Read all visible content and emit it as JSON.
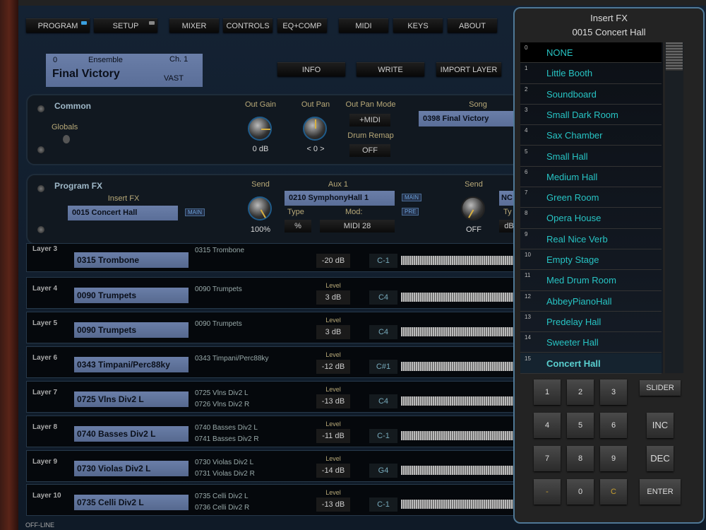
{
  "nav": {
    "tabs": [
      "PROGRAM",
      "SETUP",
      "MIXER",
      "CONTROLS",
      "EQ+COMP",
      "MIDI",
      "KEYS",
      "ABOUT"
    ]
  },
  "program": {
    "number": "0",
    "bank": "Ensemble",
    "channel": "Ch. 1",
    "name": "Final Victory",
    "type": "VAST"
  },
  "actions": {
    "info": "INFO",
    "write": "WRITE",
    "import": "IMPORT LAYER"
  },
  "common": {
    "title": "Common",
    "globals": "Globals",
    "out_gain_label": "Out Gain",
    "out_gain": "0 dB",
    "out_pan_label": "Out Pan",
    "out_pan": "< 0 >",
    "out_pan_mode_label": "Out Pan Mode",
    "out_pan_mode": "+MIDI",
    "drum_remap_label": "Drum Remap",
    "drum_remap": "OFF",
    "song_label": "Song",
    "song": "0398 Final Victory"
  },
  "fx": {
    "title": "Program FX",
    "insert_label": "Insert FX",
    "insert": "0015 Concert Hall",
    "insert_tag": "MAIN",
    "send1_label": "Send",
    "send1": "100%",
    "aux_label": "Aux 1",
    "aux": "0210 SymphonyHall 1",
    "aux_tag1": "MAIN",
    "aux_tag2": "PRE",
    "type_label": "Type",
    "type": "%",
    "mod_label": "Mod:",
    "mod": "MIDI 28",
    "send2_label": "Send",
    "send2": "OFF",
    "aux2_partial": "NC",
    "type2_partial": "Ty",
    "type2_val_partial": "dB"
  },
  "layers": [
    {
      "label": "Layer 3",
      "program": "0315 Trombone",
      "samples": [
        "0315 Trombone"
      ],
      "level_label": "",
      "level": "-20 dB",
      "key": "C-1"
    },
    {
      "label": "Layer 4",
      "program": "0090 Trumpets",
      "samples": [
        "0090 Trumpets"
      ],
      "level_label": "Level",
      "level": "3 dB",
      "key": "C4"
    },
    {
      "label": "Layer 5",
      "program": "0090 Trumpets",
      "samples": [
        "0090 Trumpets"
      ],
      "level_label": "Level",
      "level": "3 dB",
      "key": "C4"
    },
    {
      "label": "Layer 6",
      "program": "0343 Timpani/Perc88ky",
      "samples": [
        "0343 Timpani/Perc88ky"
      ],
      "level_label": "Level",
      "level": "-12 dB",
      "key": "C#1"
    },
    {
      "label": "Layer 7",
      "program": "0725 Vlns Div2 L",
      "samples": [
        "0725 Vlns Div2 L",
        "0726 Vlns Div2 R"
      ],
      "level_label": "Level",
      "level": "-13 dB",
      "key": "C4"
    },
    {
      "label": "Layer 8",
      "program": "0740 Basses Div2 L",
      "samples": [
        "0740 Basses Div2 L",
        "0741 Basses Div2 R"
      ],
      "level_label": "Level",
      "level": "-11 dB",
      "key": "C-1"
    },
    {
      "label": "Layer 9",
      "program": "0730 Violas Div2 L",
      "samples": [
        "0730 Violas Div2 L",
        "0731 Violas Div2 R"
      ],
      "level_label": "Level",
      "level": "-14 dB",
      "key": "G4"
    },
    {
      "label": "Layer 10",
      "program": "0735 Celli Div2 L",
      "samples": [
        "0735 Celli Div2 L",
        "0736 Celli Div2 R"
      ],
      "level_label": "Level",
      "level": "-13 dB",
      "key": "C-1"
    }
  ],
  "status": "OFF-LINE",
  "popup": {
    "title": "Insert FX",
    "current": "0015 Concert Hall",
    "selected_index": 15,
    "items": [
      "NONE",
      "Little Booth",
      "Soundboard",
      "Small Dark Room",
      "Sax Chamber",
      "Small Hall",
      "Medium Hall",
      "Green Room",
      "Opera House",
      "Real Nice Verb",
      "Empty Stage",
      "Med Drum Room",
      "AbbeyPianoHall",
      "Predelay Hall",
      "Sweeter Hall",
      "Concert Hall"
    ],
    "keypad": [
      "1",
      "2",
      "3",
      "4",
      "5",
      "6",
      "7",
      "8",
      "9",
      "-",
      "0",
      "C"
    ],
    "slider": "SLIDER",
    "inc": "INC",
    "dec": "DEC",
    "enter": "ENTER"
  }
}
